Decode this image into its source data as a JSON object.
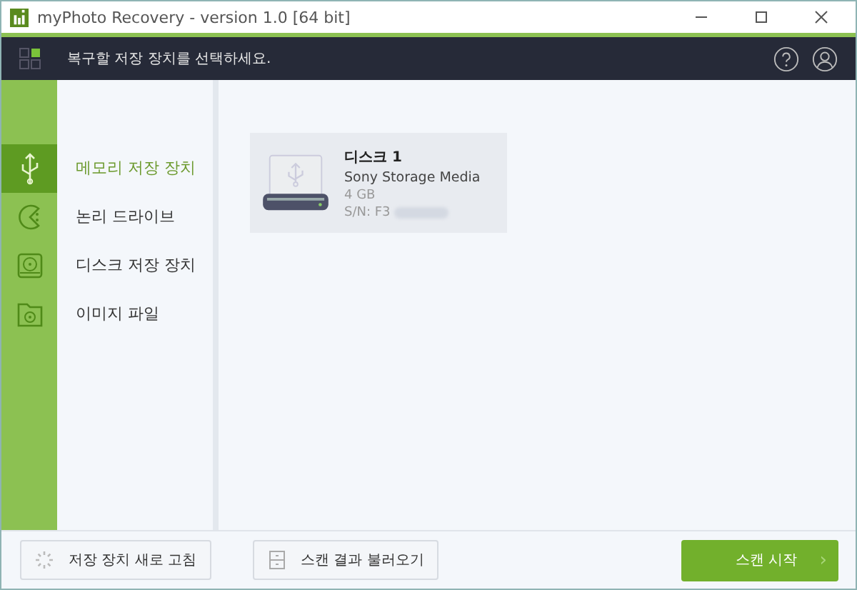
{
  "window": {
    "title": "myPhoto Recovery - version 1.0 [64 bit]"
  },
  "header": {
    "prompt": "복구할 저장 장치를 선택하세요."
  },
  "sidebar": {
    "items": [
      {
        "label": "메모리 저장 장치",
        "kind": "usb",
        "selected": true
      },
      {
        "label": "논리 드라이브",
        "kind": "partition",
        "selected": false
      },
      {
        "label": "디스크 저장 장치",
        "kind": "disk",
        "selected": false
      },
      {
        "label": "이미지 파일",
        "kind": "image",
        "selected": false
      }
    ]
  },
  "devices": [
    {
      "name": "디스크 1",
      "model": "Sony Storage Media",
      "size": "4 GB",
      "serial": "S/N: F3",
      "selected": true
    }
  ],
  "footer": {
    "refresh": "저장 장치 새로 고침",
    "load": "스캔 결과 불러오기",
    "start": "스캔 시작",
    "start_arrow": "›"
  }
}
